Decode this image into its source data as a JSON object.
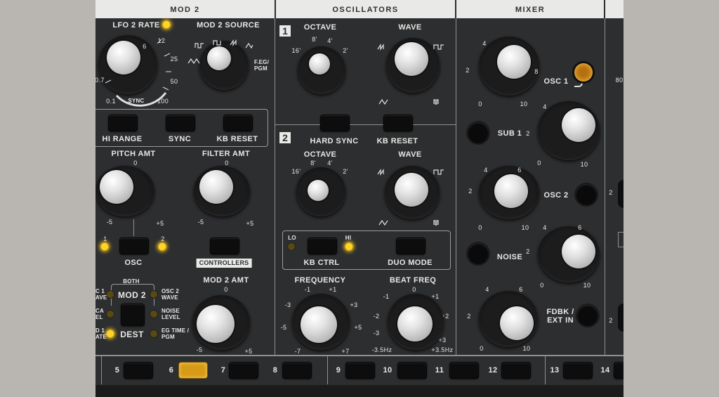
{
  "sections": {
    "mod2": "MOD 2",
    "oscillators": "OSCILLATORS",
    "mixer": "MIXER"
  },
  "mod2": {
    "lfo2_rate": "LFO 2 RATE",
    "mod2_source": "MOD 2 SOURCE",
    "rate_scale": [
      "0.1",
      "0.7",
      "SYNC",
      "100",
      "50",
      "25",
      "12",
      "6"
    ],
    "source_label": "F.EG/\nPGM",
    "hi_range": "HI RANGE",
    "sync": "SYNC",
    "kb_reset": "KB RESET",
    "pitch_amt": "PITCH AMT",
    "filter_amt": "FILTER AMT",
    "amt_scale": [
      "-5",
      "0",
      "+5"
    ],
    "osc": "OSC",
    "osc_nums": [
      "1",
      "2"
    ],
    "controllers": "CONTROLLERS",
    "both": "BOTH",
    "mod2_btn": "MOD 2",
    "dest": "DEST",
    "mod2_amt": "MOD 2 AMT",
    "dest_left": [
      "C 1\nAVE",
      "CA\nEL",
      "D 1\nATE"
    ],
    "dest_right": [
      "OSC 2\nWAVE",
      "NOISE\nLEVEL",
      "EG TIME /\nPGM"
    ]
  },
  "oscillators": {
    "osc1_num": "1",
    "osc2_num": "2",
    "octave": "OCTAVE",
    "wave": "WAVE",
    "octave_scale": [
      "16'",
      "8'",
      "4'",
      "2'"
    ],
    "hard_sync": "HARD SYNC",
    "kb_reset": "KB RESET",
    "lo": "LO",
    "hi": "HI",
    "kb_ctrl": "KB CTRL",
    "duo_mode": "DUO MODE",
    "frequency": "FREQUENCY",
    "beat_freq": "BEAT FREQ",
    "freq_scale": [
      "-7",
      "-5",
      "-3",
      "-1",
      "+1",
      "+3",
      "+5",
      "+7"
    ],
    "beat_scale": [
      "-3.5Hz",
      "-3",
      "-2",
      "-1",
      "0",
      "+1",
      "+2",
      "+3",
      "+3.5Hz"
    ]
  },
  "mixer": {
    "osc1": "OSC 1",
    "sub1": "SUB 1",
    "osc2": "OSC 2",
    "noise": "NOISE",
    "fdbk": "FDBK /\nEXT IN",
    "scale": [
      "0",
      "2",
      "4",
      "6",
      "8",
      "10"
    ],
    "edge_label": "80"
  },
  "sequencer": {
    "steps": [
      "5",
      "6",
      "7",
      "8",
      "9",
      "10",
      "11",
      "12",
      "13",
      "14"
    ],
    "lit_step": "6"
  },
  "colors": {
    "panel": "#2d2e30",
    "header": "#e9e9e7",
    "led_on": "#ffd32a",
    "step_lit": "#d69a16"
  }
}
